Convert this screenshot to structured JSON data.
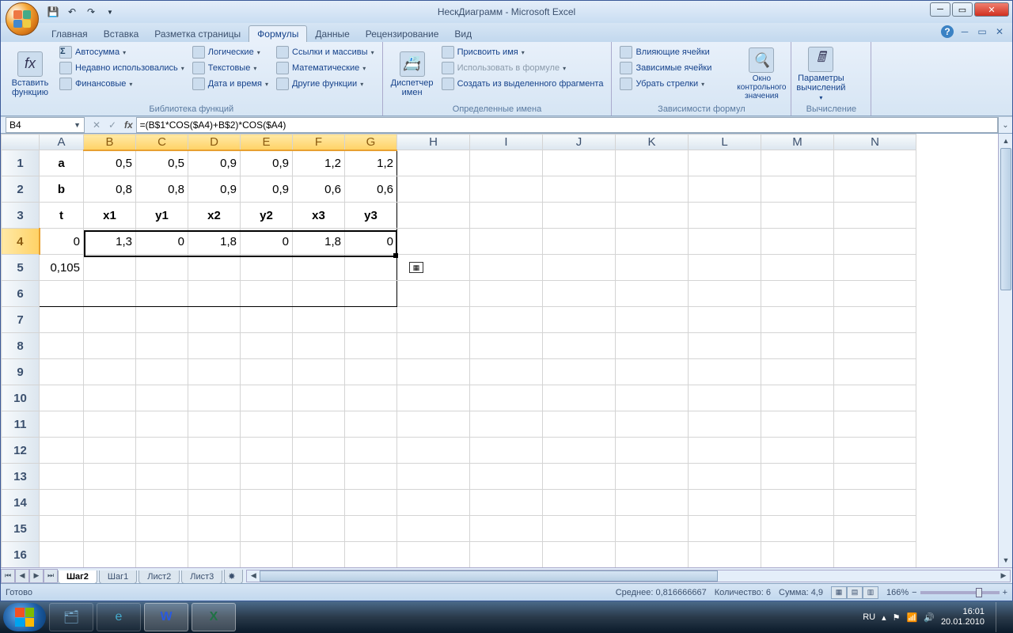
{
  "titlebar": {
    "title": "НескДиаграмм - Microsoft Excel"
  },
  "tabs": {
    "items": [
      "Главная",
      "Вставка",
      "Разметка страницы",
      "Формулы",
      "Данные",
      "Рецензирование",
      "Вид"
    ],
    "activeIndex": 3
  },
  "ribbon": {
    "group_lib": {
      "insert_fn": "Вставить функцию",
      "autosum": "Автосумма",
      "recent": "Недавно использовались",
      "financial": "Финансовые",
      "logical": "Логические",
      "text": "Текстовые",
      "datetime": "Дата и время",
      "lookup": "Ссылки и массивы",
      "math": "Математические",
      "more": "Другие функции",
      "label": "Библиотека функций"
    },
    "group_names": {
      "manager": "Диспетчер имен",
      "define": "Присвоить имя",
      "use": "Использовать в формуле",
      "create": "Создать из выделенного фрагмента",
      "label": "Определенные имена"
    },
    "group_audit": {
      "precedents": "Влияющие ячейки",
      "dependents": "Зависимые ячейки",
      "remove": "Убрать стрелки",
      "watch": "Окно контрольного значения",
      "label": "Зависимости формул"
    },
    "group_calc": {
      "options": "Параметры вычислений",
      "label": "Вычисление"
    }
  },
  "namebox": {
    "ref": "B4"
  },
  "formula": {
    "text": "=(B$1*COS($A4)+B$2)*COS($A4)"
  },
  "columns": [
    "A",
    "B",
    "C",
    "D",
    "E",
    "F",
    "G",
    "H",
    "I",
    "J",
    "K",
    "L",
    "M",
    "N"
  ],
  "sheet": {
    "r1": {
      "A": "a",
      "B": "0,5",
      "C": "0,5",
      "D": "0,9",
      "E": "0,9",
      "F": "1,2",
      "G": "1,2"
    },
    "r2": {
      "A": "b",
      "B": "0,8",
      "C": "0,8",
      "D": "0,9",
      "E": "0,9",
      "F": "0,6",
      "G": "0,6"
    },
    "r3": {
      "A": "t",
      "B": "x1",
      "C": "y1",
      "D": "x2",
      "E": "y2",
      "F": "x3",
      "G": "y3"
    },
    "r4": {
      "A": "0",
      "B": "1,3",
      "C": "0",
      "D": "1,8",
      "E": "0",
      "F": "1,8",
      "G": "0"
    },
    "r5": {
      "A": "0,105"
    }
  },
  "sheetTabs": {
    "items": [
      "Шаг2",
      "Шаг1",
      "Лист2",
      "Лист3"
    ],
    "activeIndex": 0
  },
  "status": {
    "ready": "Готово",
    "avg": "Среднее: 0,816666667",
    "count": "Количество: 6",
    "sum": "Сумма: 4,9",
    "zoom": "166%"
  },
  "taskbar": {
    "lang": "RU",
    "time": "16:01",
    "date": "20.01.2010"
  }
}
